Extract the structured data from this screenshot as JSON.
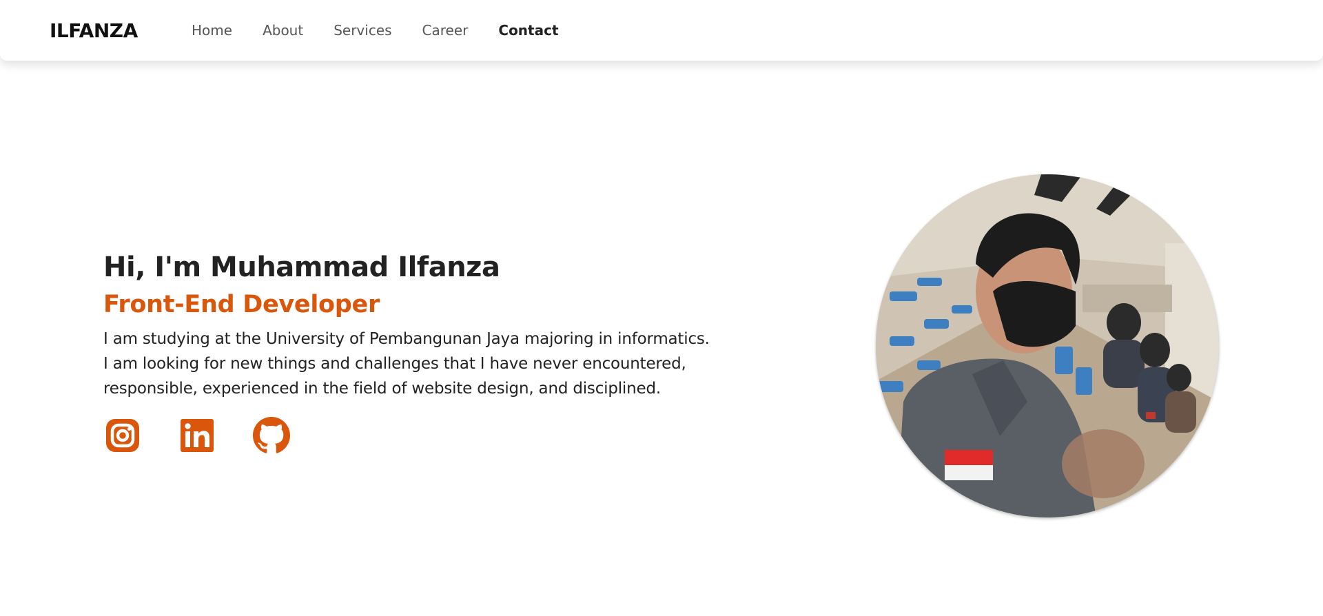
{
  "brand": {
    "name": "ILFANZA"
  },
  "nav": {
    "items": [
      {
        "label": "Home"
      },
      {
        "label": "About"
      },
      {
        "label": "Services"
      },
      {
        "label": "Career"
      },
      {
        "label": "Contact"
      }
    ],
    "active": "Contact"
  },
  "hero": {
    "greeting": "Hi, I'm Muhammad Ilfanza",
    "role": "Front-End Developer",
    "bio_lines": [
      "I am studying at the University of Pembangunan Jaya majoring in informatics.",
      "I am looking for new things and challenges that I have never encountered,",
      "responsible, experienced in the field of website design, and disciplined."
    ]
  },
  "socials": [
    {
      "icon": "instagram-icon"
    },
    {
      "icon": "linkedin-icon"
    },
    {
      "icon": "github-icon"
    }
  ],
  "colors": {
    "accent": "#d9560b",
    "text": "#222222",
    "nav_text": "#555555"
  }
}
